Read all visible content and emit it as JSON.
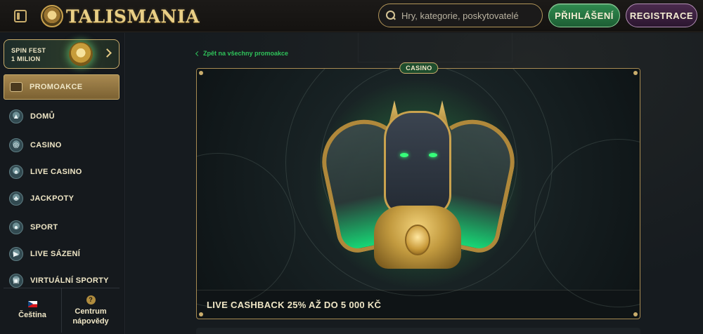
{
  "header": {
    "logo_text": "TALISMANIA",
    "search_placeholder": "Hry, kategorie, poskytovatelé",
    "login_label": "PŘIHLÁŠENÍ",
    "register_label": "REGISTRACE"
  },
  "sidebar": {
    "promo_banner": {
      "title": "SPIN FEST",
      "subtitle": "1 MILION"
    },
    "items": [
      {
        "label": "PROMOAKCE",
        "icon": "ticket-icon",
        "active": true
      },
      {
        "label": "DOMŮ",
        "icon": "pyramid-icon",
        "active": false
      },
      {
        "label": "CASINO",
        "icon": "roulette-icon",
        "active": false
      },
      {
        "label": "LIVE CASINO",
        "icon": "spade-icon",
        "active": false
      },
      {
        "label": "JACKPOTY",
        "icon": "clover-icon",
        "active": false
      },
      {
        "label": "SPORT",
        "icon": "soccer-ball-icon",
        "active": false
      },
      {
        "label": "LIVE SÁZENÍ",
        "icon": "live-play-icon",
        "active": false
      },
      {
        "label": "VIRTUÁLNÍ SPORTY",
        "icon": "gamepad-icon",
        "active": false
      }
    ],
    "footer": {
      "language": "Čeština",
      "help_line1": "Centrum",
      "help_line2": "nápovědy"
    }
  },
  "main": {
    "back_link": "Zpět na všechny promoakce",
    "promo": {
      "category": "CASINO",
      "title": "LIVE CASHBACK 25% AŽ DO 5 000 KČ"
    }
  },
  "colors": {
    "accent_gold": "#c9ad6c",
    "login_green": "#2f8b4f",
    "register_purple": "#4a2a4d",
    "link_green": "#2fc25a",
    "background": "#14181c"
  }
}
